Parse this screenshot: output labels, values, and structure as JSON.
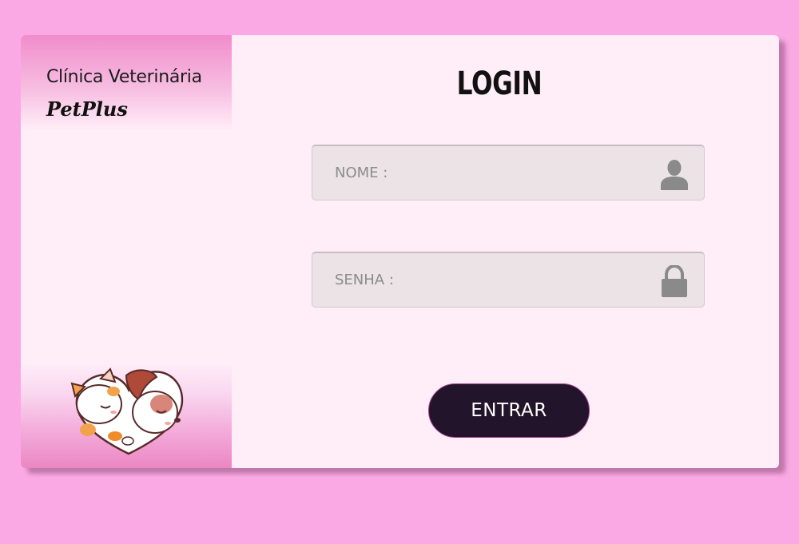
{
  "brand": {
    "line1": "Clínica Veterinária",
    "line2": "PetPlus",
    "logo_icon": "cat-and-dog-heart-logo"
  },
  "login": {
    "title": "LOGIN",
    "nome": {
      "placeholder": "NOME :",
      "value": "",
      "icon": "user-icon"
    },
    "senha": {
      "placeholder": "SENHA :",
      "value": "",
      "icon": "lock-icon"
    },
    "submit_label": "ENTRAR"
  },
  "colors": {
    "background": "#fba9e4",
    "card": "#ffedf7",
    "sidebar_accent": "#f18ccb",
    "field": "#ebe3e5",
    "button": "#22142a",
    "icon": "#8a8a8a"
  }
}
